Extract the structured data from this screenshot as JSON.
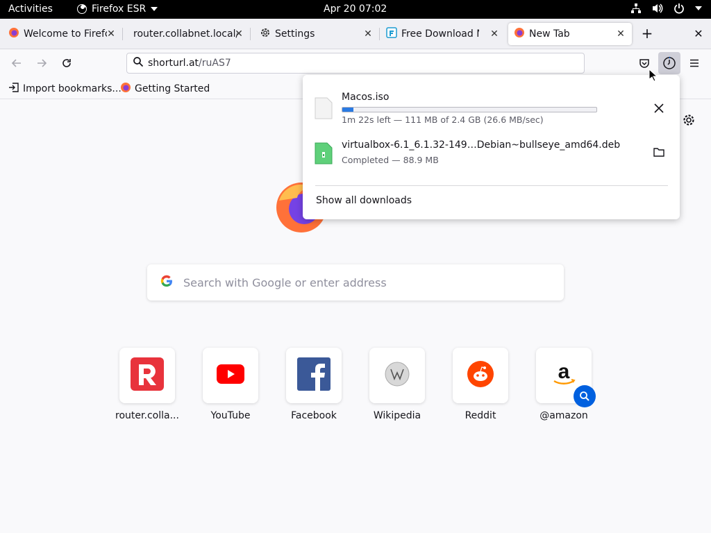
{
  "topbar": {
    "activities": "Activities",
    "app_name": "Firefox ESR",
    "clock": "Apr 20  07:02"
  },
  "tabs": [
    {
      "label": "Welcome to Firefox",
      "favicon": "firefox-icon"
    },
    {
      "label": "router.collabnet.local/",
      "favicon": "none"
    },
    {
      "label": "Settings",
      "favicon": "gear-icon"
    },
    {
      "label": "Free Download Ma",
      "favicon": "fdm-icon"
    },
    {
      "label": "New Tab",
      "favicon": "firefox-icon",
      "active": true
    }
  ],
  "urlbar": {
    "host": "shorturl.at",
    "path": "/ruAS7"
  },
  "bookmarks": [
    {
      "label": "Import bookmarks...",
      "icon": "import-icon"
    },
    {
      "label": "Getting Started",
      "icon": "firefox-icon"
    }
  ],
  "search": {
    "placeholder": "Search with Google or enter address"
  },
  "top_sites": [
    {
      "label": "router.colla...",
      "icon": "router-icon"
    },
    {
      "label": "YouTube",
      "icon": "youtube-icon"
    },
    {
      "label": "Facebook",
      "icon": "facebook-icon"
    },
    {
      "label": "Wikipedia",
      "icon": "wikipedia-icon"
    },
    {
      "label": "Reddit",
      "icon": "reddit-icon"
    },
    {
      "label": "@amazon",
      "icon": "amazon-icon"
    }
  ],
  "downloads": {
    "items": [
      {
        "filename": "Macos.iso",
        "status": "1m 22s left — 111 MB of 2.4 GB (26.6 MB/sec)",
        "progress": 0.045,
        "action": "cancel"
      },
      {
        "filename": "virtualbox-6.1_6.1.32-149…Debian~bullseye_amd64.deb",
        "status": "Completed — 88.9 MB",
        "action": "open-folder"
      }
    ],
    "show_all": "Show all downloads"
  },
  "colors": {
    "accent": "#0060df",
    "progress": "#2a7ae2"
  }
}
